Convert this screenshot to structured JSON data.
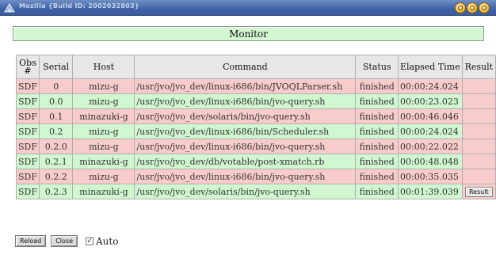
{
  "window": {
    "title": "Mozilla {Build ID: 2002032803}",
    "icon": "mozilla-app-icon",
    "controls": [
      "minimize-icon",
      "maximize-icon",
      "close-icon"
    ]
  },
  "monitor": {
    "label": "Monitor"
  },
  "table": {
    "headers": {
      "obs_line1": "Obs",
      "obs_line2": "#",
      "serial": "Serial",
      "host": "Host",
      "command": "Command",
      "status": "Status",
      "elapsed": "Elapsed Time",
      "result": "Result"
    },
    "rows": [
      {
        "obs": "SDF",
        "serial": "0",
        "host": "mizu-g",
        "command": "/usr/jvo/jvo_dev/linux-i686/bin/JVOQLParser.sh",
        "status": "finished",
        "elapsed": "00:00:24.024",
        "row_color": "red",
        "has_result_button": false
      },
      {
        "obs": "SDF",
        "serial": "0.0",
        "host": "mizu-g",
        "command": "/usr/jvo/jvo_dev/linux-i686/bin/jvo-query.sh",
        "status": "finished",
        "elapsed": "00:00:23.023",
        "row_color": "green",
        "has_result_button": false
      },
      {
        "obs": "SDF",
        "serial": "0.1",
        "host": "minazuki-g",
        "command": "/usr/jvo/jvo_dev/solaris/bin/jvo-query.sh",
        "status": "finished",
        "elapsed": "00:00:46.046",
        "row_color": "red",
        "has_result_button": false
      },
      {
        "obs": "SDF",
        "serial": "0.2",
        "host": "mizu-g",
        "command": "/usr/jvo/jvo_dev/linux-i686/bin/Scheduler.sh",
        "status": "finished",
        "elapsed": "00:00:24.024",
        "row_color": "green",
        "has_result_button": false
      },
      {
        "obs": "SDF",
        "serial": "0.2.0",
        "host": "mizu-g",
        "command": "/usr/jvo/jvo_dev/linux-i686/bin/jvo-query.sh",
        "status": "finished",
        "elapsed": "00:00:22.022",
        "row_color": "red",
        "has_result_button": false
      },
      {
        "obs": "SDF",
        "serial": "0.2.1",
        "host": "minazuki-g",
        "command": "/usr/jvo/jvo_dev/db/votable/post-xmatch.rb",
        "status": "finished",
        "elapsed": "00:00:48.048",
        "row_color": "green",
        "has_result_button": false
      },
      {
        "obs": "SDF",
        "serial": "0.2.2",
        "host": "mizu-g",
        "command": "/usr/jvo/jvo_dev/linux-i686/bin/jvo-query.sh",
        "status": "finished",
        "elapsed": "00:00:35.035",
        "row_color": "red",
        "has_result_button": false
      },
      {
        "obs": "SDF",
        "serial": "0.2.3",
        "host": "minazuki-g",
        "command": "/usr/jvo/jvo_dev/solaris/bin/jvo-query.sh",
        "status": "finished",
        "elapsed": "00:01:39.039",
        "row_color": "green",
        "has_result_button": true,
        "result_label": "Result"
      }
    ]
  },
  "controls": {
    "reload_label": "Reload",
    "close_label": "Close",
    "auto_label": "Auto",
    "auto_checked": true,
    "check_glyph": "✓"
  },
  "colors": {
    "title_bar": "#3f62a6",
    "monitor_bg": "#d2f7d2",
    "row_red": "#f9cccc",
    "row_green": "#d0f7d0",
    "header_bg": "#e7e7e7"
  }
}
